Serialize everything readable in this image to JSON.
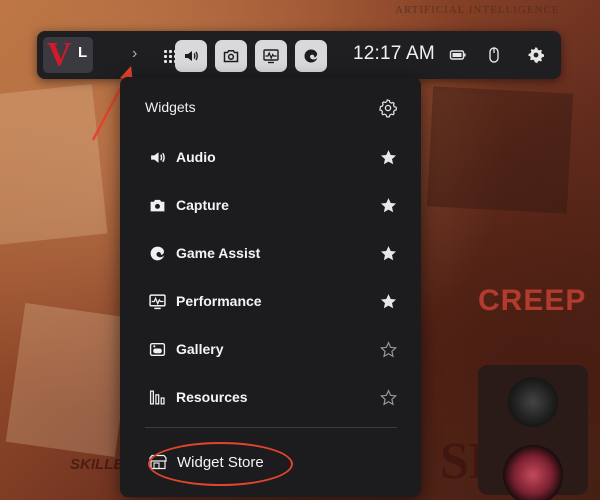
{
  "topbar": {
    "game_thumb_letters": [
      "V",
      "L"
    ],
    "clock": "12:17 AM",
    "buttons": [
      {
        "name": "audio-widget-button",
        "icon": "speaker-icon"
      },
      {
        "name": "capture-widget-button",
        "icon": "camera-icon"
      },
      {
        "name": "performance-widget-button",
        "icon": "monitor-graph-icon"
      },
      {
        "name": "game-assist-widget-button",
        "icon": "edge-icon"
      }
    ],
    "status_icons": [
      "battery-icon",
      "mouse-icon",
      "settings-gear-icon"
    ]
  },
  "panel": {
    "title": "Widgets",
    "items": [
      {
        "label": "Audio",
        "icon": "speaker-icon",
        "favorite": true
      },
      {
        "label": "Capture",
        "icon": "camera-icon",
        "favorite": true
      },
      {
        "label": "Game Assist",
        "icon": "edge-icon",
        "favorite": true
      },
      {
        "label": "Performance",
        "icon": "monitor-graph-icon",
        "favorite": true
      },
      {
        "label": "Gallery",
        "icon": "gallery-controller-icon",
        "favorite": false
      },
      {
        "label": "Resources",
        "icon": "resources-bars-icon",
        "favorite": false
      }
    ],
    "store_label": "Widget Store"
  },
  "background": {
    "top_text": "ARTIFICIAL INTELLIGENCE",
    "poster_text": "CREEP",
    "logo_text": "SKILLE",
    "set_text": "SET"
  },
  "colors": {
    "annotation": "#e2452c",
    "panel_bg": "#1c1c1e",
    "button_active": "#d9d9dc"
  }
}
